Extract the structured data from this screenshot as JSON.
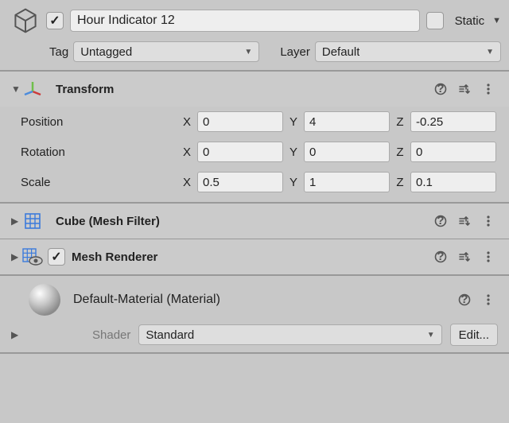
{
  "header": {
    "active": true,
    "name": "Hour Indicator 12",
    "static_label": "Static",
    "static_checked": false
  },
  "tagrow": {
    "tag_label": "Tag",
    "tag_value": "Untagged",
    "layer_label": "Layer",
    "layer_value": "Default"
  },
  "transform": {
    "title": "Transform",
    "position_label": "Position",
    "rotation_label": "Rotation",
    "scale_label": "Scale",
    "x_label": "X",
    "y_label": "Y",
    "z_label": "Z",
    "position": {
      "x": "0",
      "y": "4",
      "z": "-0.25"
    },
    "rotation": {
      "x": "0",
      "y": "0",
      "z": "0"
    },
    "scale": {
      "x": "0.5",
      "y": "1",
      "z": "0.1"
    }
  },
  "meshfilter": {
    "title": "Cube (Mesh Filter)"
  },
  "meshrenderer": {
    "title": "Mesh Renderer",
    "enabled": true
  },
  "material": {
    "title": "Default-Material (Material)",
    "shader_label": "Shader",
    "shader_value": "Standard",
    "edit_label": "Edit..."
  }
}
